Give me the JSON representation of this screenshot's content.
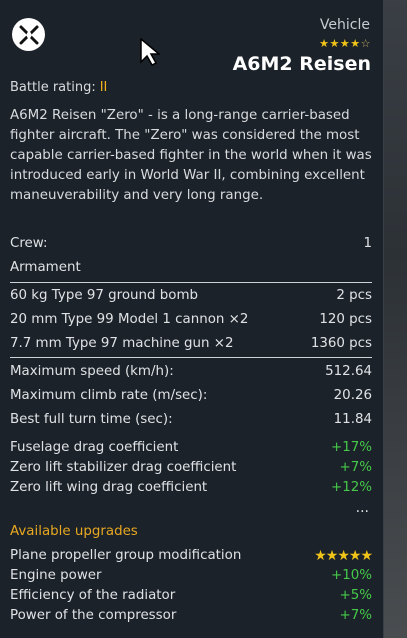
{
  "header": {
    "label": "Vehicle",
    "stars_on": "★★★★",
    "stars_off": "☆",
    "name": "A6M2 Reisen",
    "type_icon": "fighter-crossed-icon"
  },
  "battle_rating": {
    "label": "Battle rating:",
    "value": "II"
  },
  "description": "A6M2 Reisen \"Zero\" - is a long-range carrier-based fighter aircraft. The \"Zero\" was considered the most capable carrier-based fighter in the world when it was introduced early in World War II, combining excellent maneuverability and very long range.",
  "crew": {
    "label": "Crew:",
    "value": "1"
  },
  "armament": {
    "title": "Armament",
    "items": [
      {
        "name": "60 kg Type 97 ground bomb",
        "value": "2 pcs"
      },
      {
        "name": "20 mm Type 99 Model 1 cannon ×2",
        "value": "120 pcs"
      },
      {
        "name": "7.7 mm Type 97 machine gun ×2",
        "value": "1360 pcs"
      }
    ]
  },
  "performance": [
    {
      "name": "Maximum speed (km/h):",
      "value": "512.64"
    },
    {
      "name": "Maximum climb rate (m/sec):",
      "value": "20.26"
    },
    {
      "name": "Best full turn time (sec):",
      "value": "11.84"
    }
  ],
  "modifiers": [
    {
      "name": "Fuselage drag coefficient",
      "value": "+17%"
    },
    {
      "name": "Zero lift stabilizer drag coefficient",
      "value": "+7%"
    },
    {
      "name": "Zero lift wing drag coefficient",
      "value": "+12%"
    }
  ],
  "more": "...",
  "upgrades": {
    "title": "Available upgrades",
    "items": [
      {
        "name": "Plane propeller group modification",
        "value": "★★★★★"
      },
      {
        "name": "Engine power",
        "value": "+10%"
      },
      {
        "name": "Efficiency of the radiator",
        "value": "+5%"
      },
      {
        "name": "Power of the compressor",
        "value": "+7%"
      }
    ]
  },
  "colors": {
    "accent_gold": "#e8a820",
    "positive_green": "#45c94a",
    "panel_bg": "#1c2229"
  }
}
